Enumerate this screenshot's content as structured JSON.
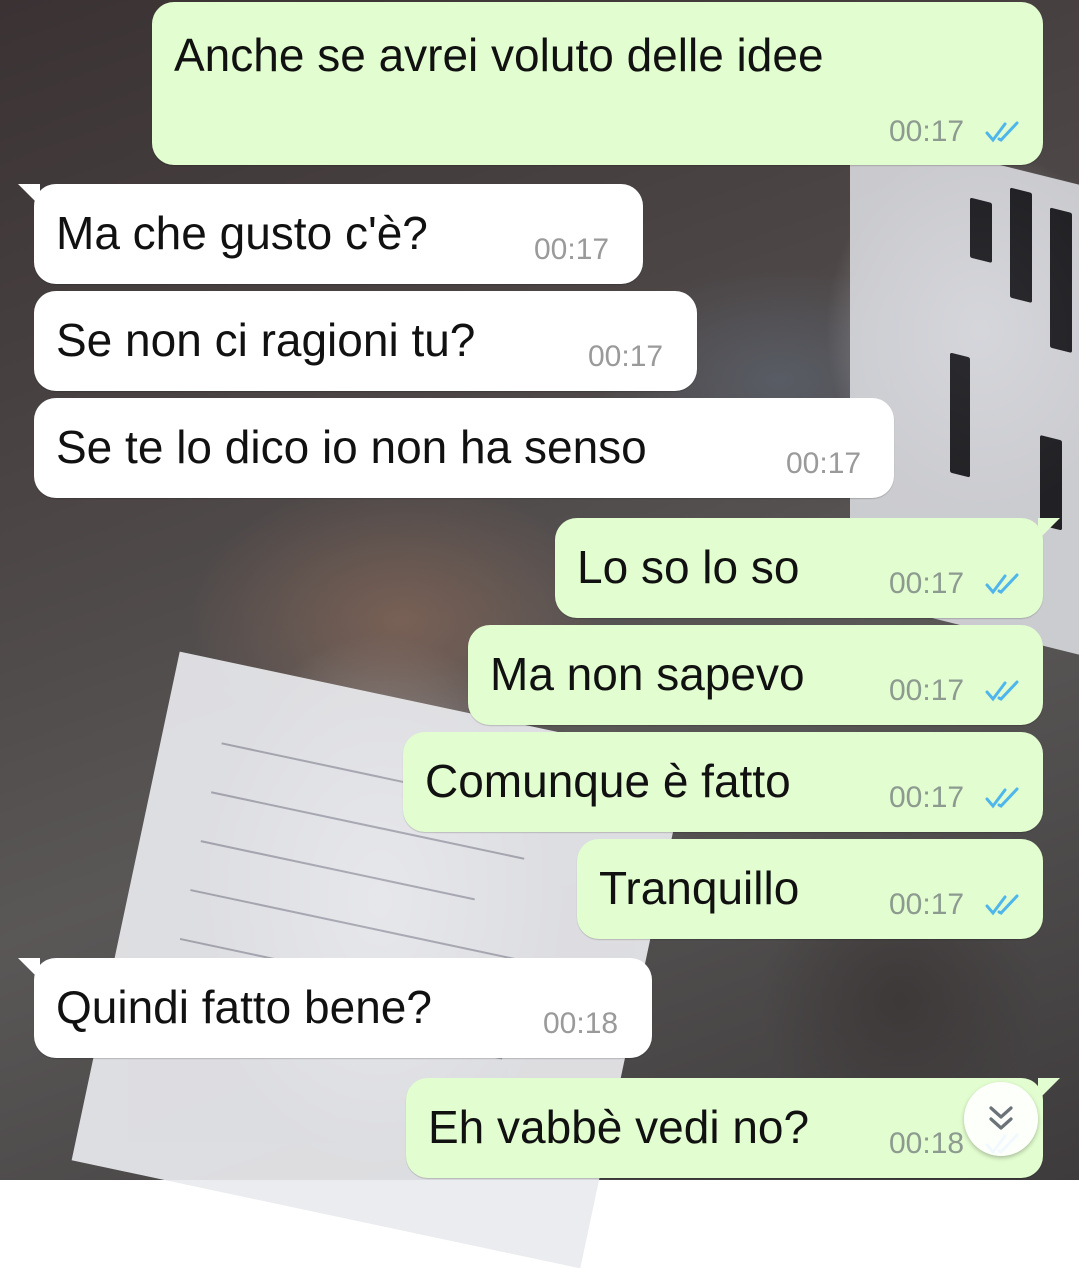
{
  "messages": [
    {
      "direction": "out",
      "text": "Anche se avrei voluto delle idee",
      "time": "00:17",
      "status": "read"
    },
    {
      "direction": "in",
      "text": "Ma che gusto c'è?",
      "time": "00:17"
    },
    {
      "direction": "in",
      "text": "Se non ci ragioni tu?",
      "time": "00:17"
    },
    {
      "direction": "in",
      "text": "Se te lo dico io non ha senso",
      "time": "00:17"
    },
    {
      "direction": "out",
      "text": "Lo so lo so",
      "time": "00:17",
      "status": "read"
    },
    {
      "direction": "out",
      "text": "Ma non sapevo",
      "time": "00:17",
      "status": "read"
    },
    {
      "direction": "out",
      "text": "Comunque è fatto",
      "time": "00:17",
      "status": "read"
    },
    {
      "direction": "out",
      "text": "Tranquillo",
      "time": "00:17",
      "status": "read"
    },
    {
      "direction": "in",
      "text": "Quindi fatto bene?",
      "time": "00:18"
    },
    {
      "direction": "out",
      "text": "Eh vabbè vedi no?",
      "time": "00:18",
      "status": "read"
    }
  ],
  "colors": {
    "outgoing_bubble": "#e2fdcf",
    "incoming_bubble": "#ffffff",
    "read_ticks": "#4fb6ec"
  },
  "icons": {
    "read_status": "double-check-icon",
    "scroll_down": "chevron-double-down-icon"
  }
}
